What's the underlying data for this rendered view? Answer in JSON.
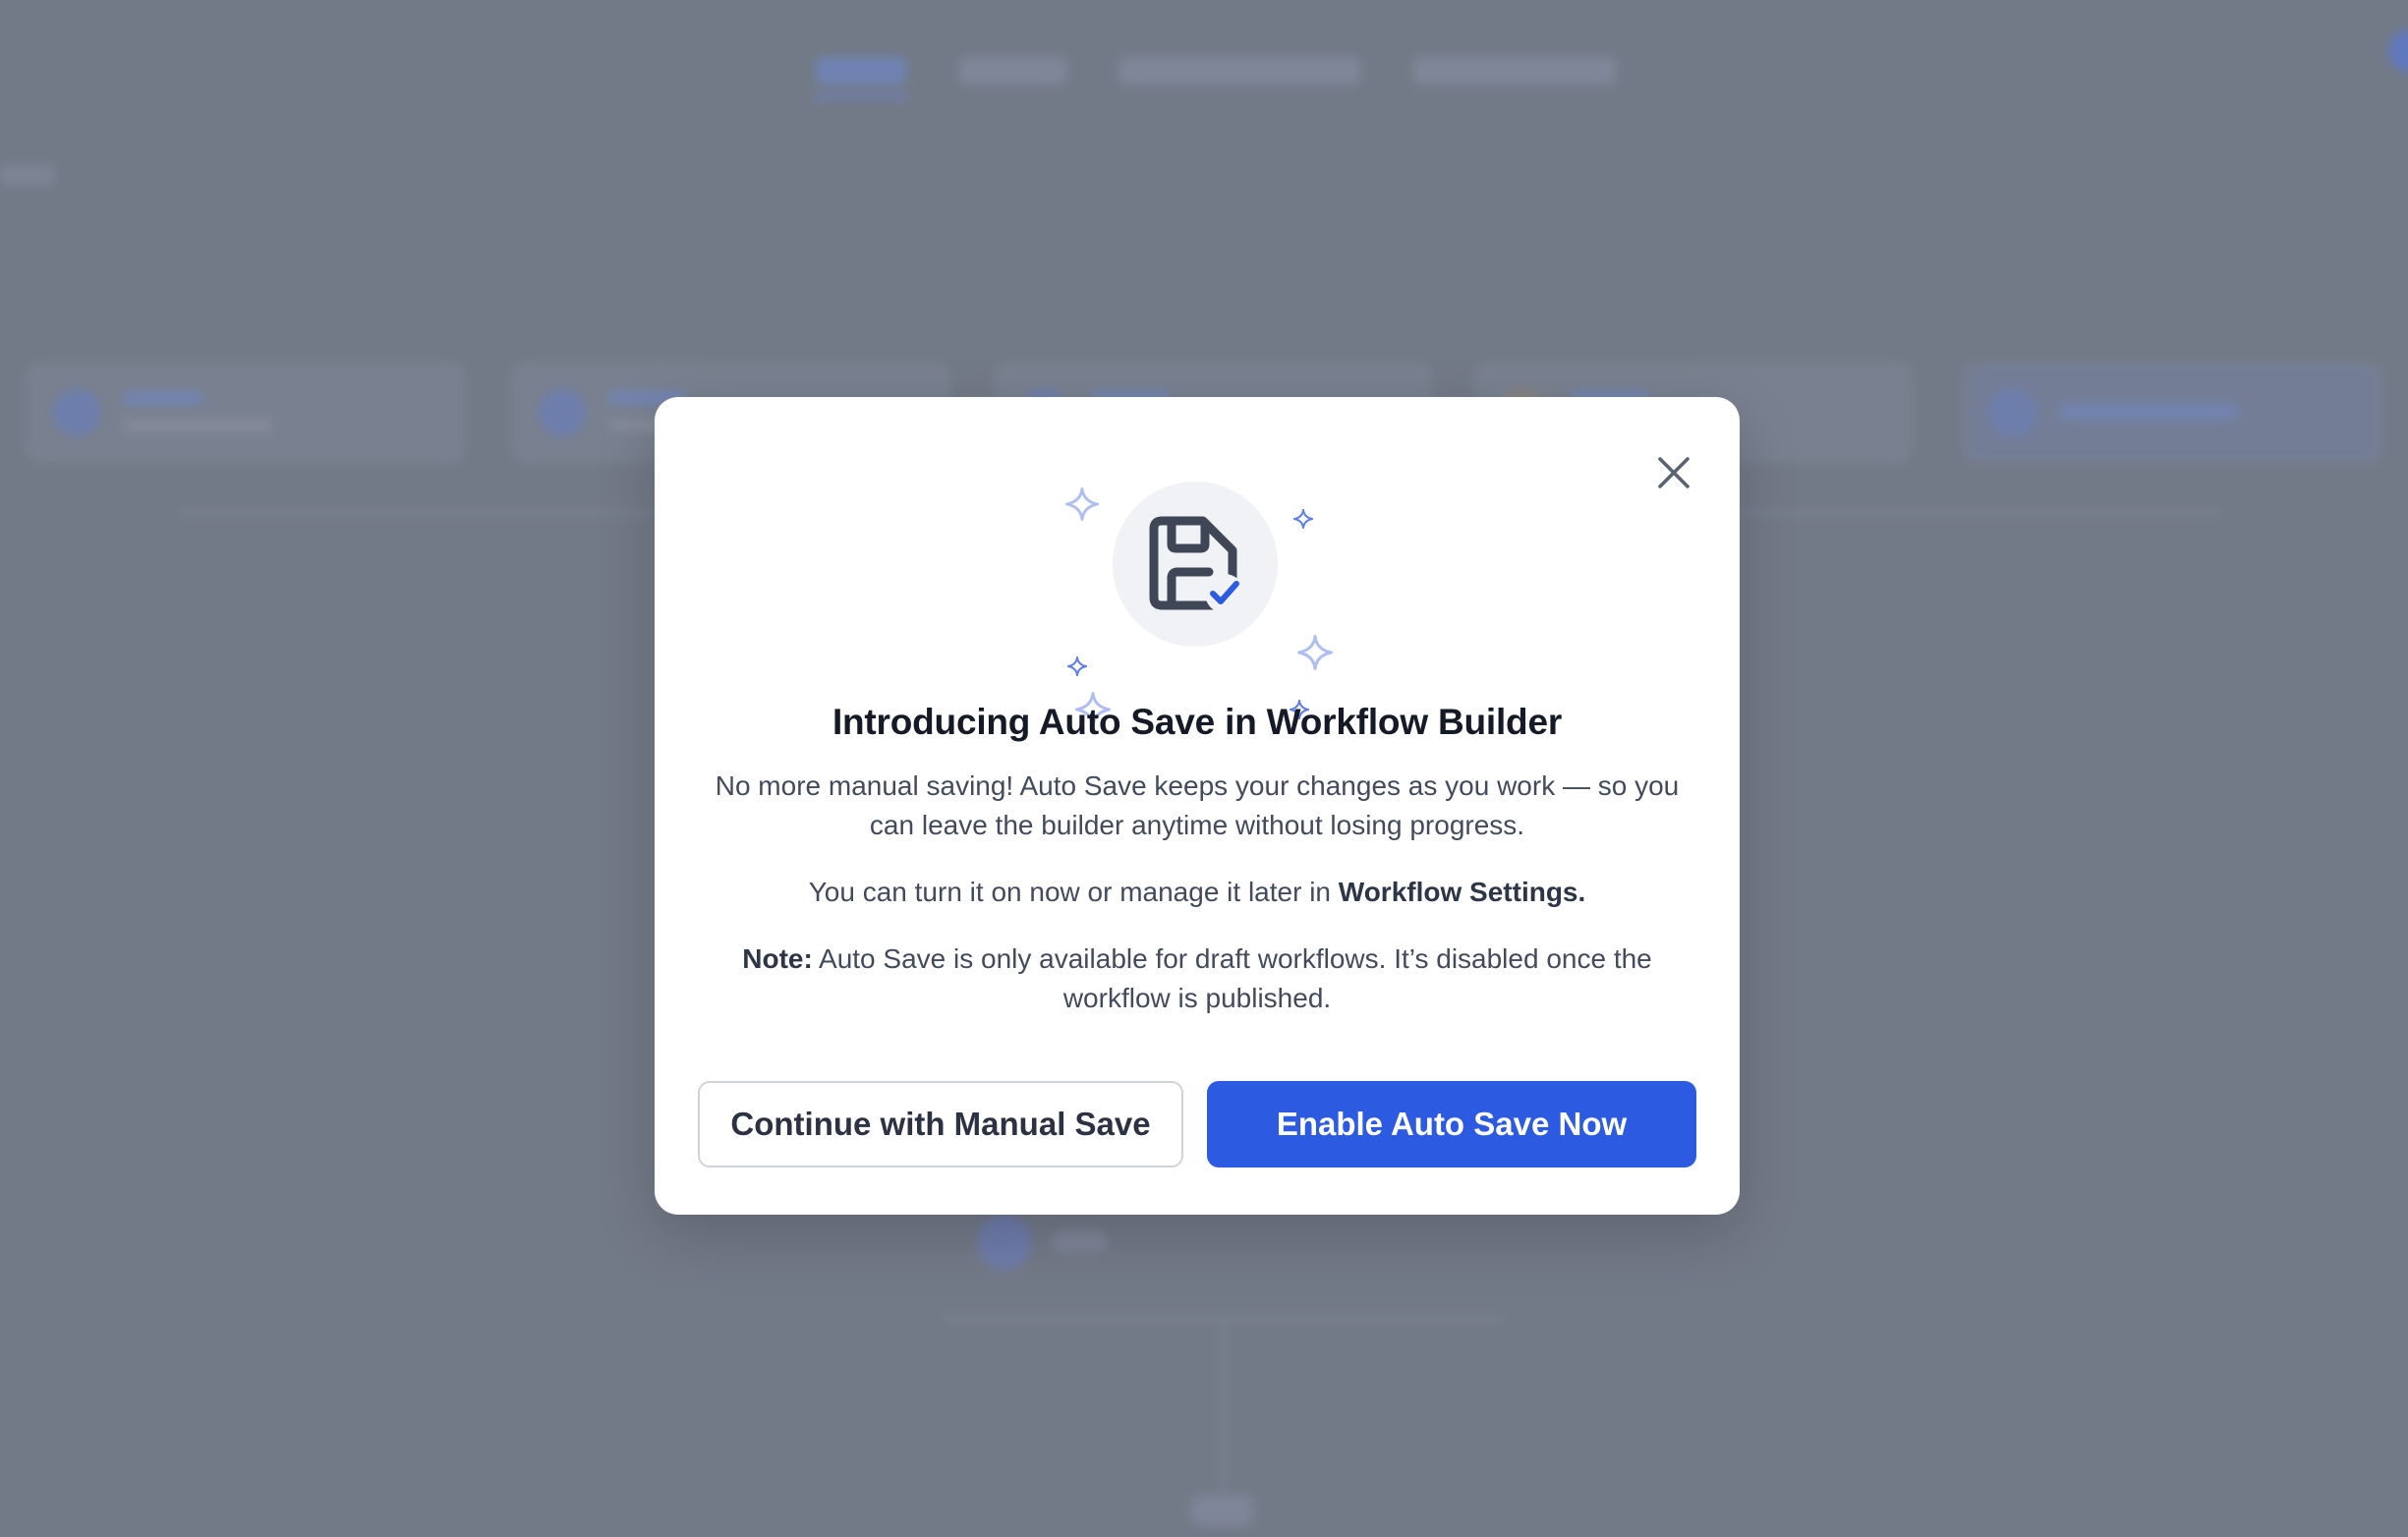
{
  "modal": {
    "title": "Introducing Auto Save in Workflow Builder",
    "paragraph_1": "No more manual saving! Auto Save keeps your changes as you work — so you can leave the builder anytime without losing progress.",
    "paragraph_2_prefix": "You can turn it on now or manage it later in ",
    "paragraph_2_bold": "Workflow Settings.",
    "note_label": "Note:",
    "note_text": " Auto Save is only available for draft workflows. It’s disabled once the workflow is published.",
    "secondary_button_label": "Continue with Manual Save",
    "primary_button_label": "Enable Auto Save Now",
    "icons": {
      "hero": "save-check-icon",
      "close": "close-icon",
      "decoration": "sparkle-icon"
    }
  },
  "colors": {
    "overlay": "#737a87",
    "primary": "#2c5ae0",
    "title": "#141a26",
    "body_text": "#424b5c",
    "sparkle": "#aebef0"
  }
}
